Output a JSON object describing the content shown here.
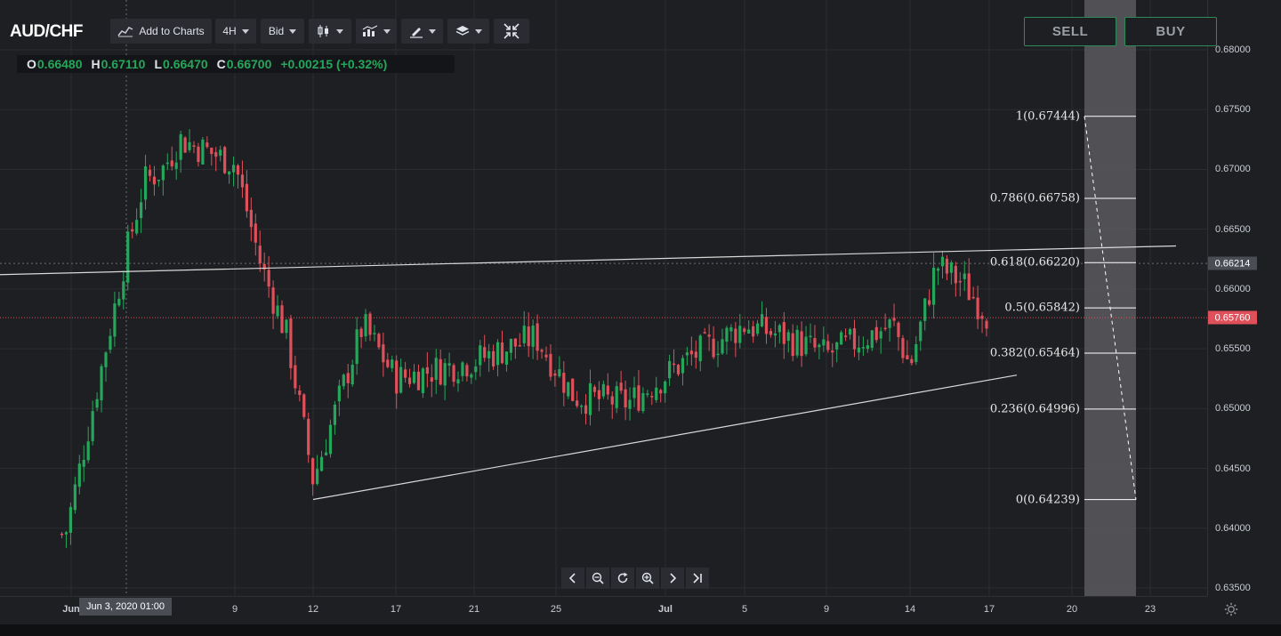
{
  "header": {
    "symbol": "AUD/CHF",
    "add_to_charts": "Add to Charts",
    "interval": "4H",
    "price_type": "Bid",
    "icons": [
      "chart-type-icon",
      "indicators-icon",
      "drawing-tools-icon",
      "layers-icon",
      "collapse-icon"
    ]
  },
  "ohlc": {
    "o_label": "O",
    "o": "0.66480",
    "h_label": "H",
    "h": "0.67110",
    "l_label": "L",
    "l": "0.66470",
    "c_label": "C",
    "c": "0.66700",
    "change": "+0.00215 (+0.32%)"
  },
  "trade": {
    "sell": "SELL",
    "buy": "BUY"
  },
  "price_axis": {
    "ticks": [
      "0.68000",
      "0.67500",
      "0.67000",
      "0.66500",
      "0.66000",
      "0.65500",
      "0.65000",
      "0.64500",
      "0.64000",
      "0.63500"
    ],
    "crosshair_price": "0.66214",
    "last_price": "0.65760"
  },
  "time_axis": {
    "labels": [
      "Jun",
      "9",
      "12",
      "17",
      "21",
      "25",
      "Jul",
      "5",
      "9",
      "14",
      "17",
      "20",
      "23"
    ],
    "crosshair_time": "Jun 3, 2020   01:00"
  },
  "fibonacci": [
    {
      "label": "1(0.67444)",
      "value": 0.67444
    },
    {
      "label": "0.786(0.66758)",
      "value": 0.66758
    },
    {
      "label": "0.618(0.66220)",
      "value": 0.6622
    },
    {
      "label": "0.5(0.65842)",
      "value": 0.65842
    },
    {
      "label": "0.382(0.65464)",
      "value": 0.65464
    },
    {
      "label": "0.236(0.64996)",
      "value": 0.64996
    },
    {
      "label": "0(0.64239)",
      "value": 0.64239
    }
  ],
  "colors": {
    "up": "#26a65b",
    "down": "#e0505a",
    "background": "#1e1f22",
    "grid": "#2a2c30",
    "trendline": "#d9d9d9"
  },
  "nav_icons": [
    "scroll-left-icon",
    "zoom-out-icon",
    "reset-icon",
    "zoom-in-icon",
    "scroll-right-icon",
    "go-to-latest-icon"
  ],
  "chart_data": {
    "type": "candlestick",
    "title": "AUD/CHF",
    "interval": "4H",
    "ylim": [
      0.6335,
      0.6805
    ],
    "x_labels": [
      "Jun",
      "9",
      "12",
      "17",
      "21",
      "25",
      "Jul",
      "5",
      "9",
      "14",
      "17",
      "20",
      "23"
    ],
    "approx_path": [
      {
        "date": "Jun 1",
        "price": 0.6395
      },
      {
        "date": "Jun 3",
        "price": 0.663
      },
      {
        "date": "Jun 4",
        "price": 0.669
      },
      {
        "date": "Jun 5",
        "price": 0.67
      },
      {
        "date": "Jun 6",
        "price": 0.6725
      },
      {
        "date": "Jun 9",
        "price": 0.6705
      },
      {
        "date": "Jun 10",
        "price": 0.662
      },
      {
        "date": "Jun 11",
        "price": 0.656
      },
      {
        "date": "Jun 12",
        "price": 0.644
      },
      {
        "date": "Jun 15",
        "price": 0.657
      },
      {
        "date": "Jun 17",
        "price": 0.6525
      },
      {
        "date": "Jun 21",
        "price": 0.654
      },
      {
        "date": "Jun 24",
        "price": 0.656
      },
      {
        "date": "Jun 26",
        "price": 0.651
      },
      {
        "date": "Jun 29",
        "price": 0.6505
      },
      {
        "date": "Jul 2",
        "price": 0.654
      },
      {
        "date": "Jul 5",
        "price": 0.657
      },
      {
        "date": "Jul 7",
        "price": 0.656
      },
      {
        "date": "Jul 9",
        "price": 0.6545
      },
      {
        "date": "Jul 13",
        "price": 0.657
      },
      {
        "date": "Jul 14",
        "price": 0.6535
      },
      {
        "date": "Jul 15",
        "price": 0.662
      },
      {
        "date": "Jul 16",
        "price": 0.6605
      },
      {
        "date": "Jul 17",
        "price": 0.6576
      }
    ],
    "trendlines": [
      {
        "name": "upper",
        "from": {
          "date": "May 28",
          "price": 0.6611
        },
        "to": {
          "date": "Jul 24",
          "price": 0.6636
        }
      },
      {
        "name": "lower",
        "from": {
          "date": "Jun 12",
          "price": 0.6424
        },
        "to": {
          "date": "Jul 18",
          "price": 0.6528
        }
      }
    ],
    "last_price": 0.6576,
    "crosshair_price": 0.66214
  }
}
